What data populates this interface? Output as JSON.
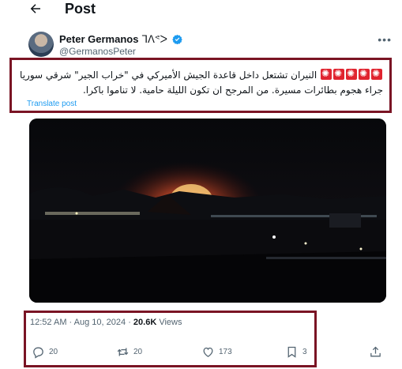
{
  "header": {
    "title": "Post"
  },
  "author": {
    "name": "Peter Germanos",
    "name_suffix": "ᒣᐱᕝᐳ",
    "handle": "@GermanosPeter"
  },
  "tweet": {
    "text": "النيران تشتعل داخل قاعدة الجيش الأميركي في \"خراب الجير\" شرقي سوريا جراء هجوم بطائرات مسيرة. من المرجح ان تكون الليلة حامية. لا تناموا باكرا.",
    "emoji_count": 5,
    "emoji_icon": "red-alarm-icon",
    "translate_label": "Translate post"
  },
  "meta": {
    "time": "12:52 AM",
    "separator": "·",
    "date": "Aug 10, 2024",
    "views_count": "20.6K",
    "views_label": "Views"
  },
  "actions": {
    "replies": "20",
    "reposts": "20",
    "likes": "173",
    "bookmarks": "3"
  },
  "colors": {
    "annotation_border": "#7a1424",
    "link": "#1d9bf0",
    "verified": "#1d9bf0",
    "secondary_text": "#536471"
  }
}
